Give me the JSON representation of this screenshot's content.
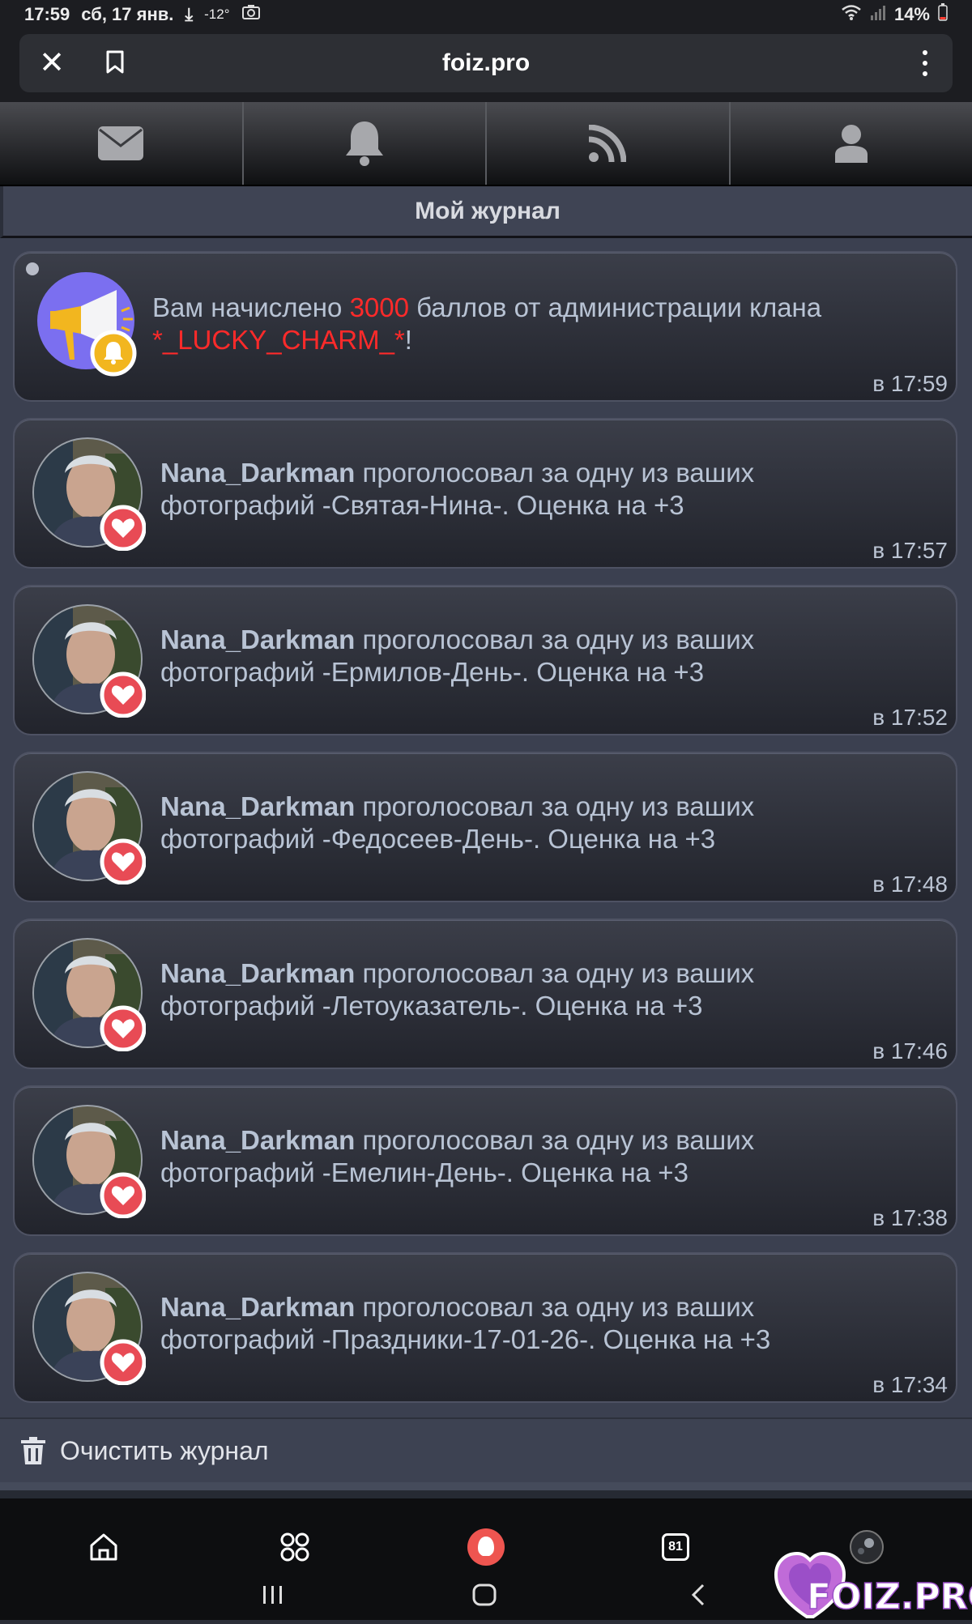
{
  "status": {
    "time": "17:59",
    "date": "сб, 17 янв.",
    "temperature": "-12°",
    "battery": "14%"
  },
  "browser": {
    "url": "foiz.pro"
  },
  "tabs": [
    {
      "icon": "mail-icon"
    },
    {
      "icon": "bell-icon"
    },
    {
      "icon": "rss-icon"
    },
    {
      "icon": "user-icon"
    }
  ],
  "journal": {
    "title": "Мой журнал",
    "clear_label": "Очистить журнал"
  },
  "notifications": [
    {
      "type": "clan",
      "text_before": "Вам начислено ",
      "highlight": "3000",
      "text_middle": " баллов от администрации клана ",
      "clan": "*_LUCKY_CHARM_*",
      "text_after": "!",
      "time": "в 17:59"
    },
    {
      "user": "Nana_Darkman",
      "text": " проголосовал за одну из ваших фотографий -Святая-Нина-. Оценка на +3",
      "time": "в 17:57"
    },
    {
      "user": "Nana_Darkman",
      "text": " проголосовал за одну из ваших фотографий -Ермилов-День-. Оценка на +3",
      "time": "в 17:52"
    },
    {
      "user": "Nana_Darkman",
      "text": " проголосовал за одну из ваших фотографий -Федосеев-День-. Оценка на +3",
      "time": "в 17:48"
    },
    {
      "user": "Nana_Darkman",
      "text": " проголосовал за одну из ваших фотографий -Летоуказатель-. Оценка на +3",
      "time": "в 17:46"
    },
    {
      "user": "Nana_Darkman",
      "text": " проголосовал за одну из ваших фотографий -Емелин-День-. Оценка на +3",
      "time": "в 17:38"
    },
    {
      "user": "Nana_Darkman",
      "text": " проголосовал за одну из ваших фотографий -Праздники-17-01-26-. Оценка на +3",
      "time": "в 17:34"
    }
  ],
  "bottom_nav": {
    "counter": "81"
  },
  "watermark": "FOIZ.PRO",
  "colors": {
    "highlight": "#ff2a2a",
    "heart_badge": "#e84b55",
    "bell_badge": "#f2b61f"
  }
}
